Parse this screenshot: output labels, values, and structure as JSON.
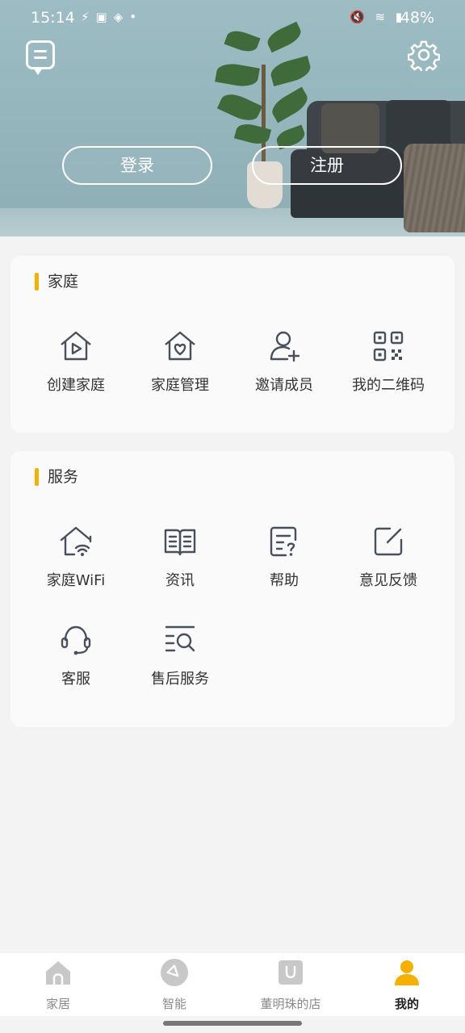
{
  "status_bar": {
    "time": "15:14",
    "battery": "48%"
  },
  "header": {
    "login_label": "登录",
    "register_label": "注册"
  },
  "home_section": {
    "title": "家庭",
    "items": [
      {
        "label": "创建家庭",
        "icon": "house-play-icon"
      },
      {
        "label": "家庭管理",
        "icon": "house-heart-icon"
      },
      {
        "label": "邀请成员",
        "icon": "user-add-icon"
      },
      {
        "label": "我的二维码",
        "icon": "qr-code-icon"
      }
    ]
  },
  "service_section": {
    "title": "服务",
    "items": [
      {
        "label": "家庭WiFi",
        "icon": "house-wifi-icon"
      },
      {
        "label": "资讯",
        "icon": "book-icon"
      },
      {
        "label": "帮助",
        "icon": "help-doc-icon"
      },
      {
        "label": "意见反馈",
        "icon": "edit-icon"
      },
      {
        "label": "客服",
        "icon": "headset-icon"
      },
      {
        "label": "售后服务",
        "icon": "search-list-icon"
      }
    ]
  },
  "bottom_nav": {
    "items": [
      {
        "label": "家居",
        "icon": "home-icon"
      },
      {
        "label": "智能",
        "icon": "smart-icon"
      },
      {
        "label": "董明珠的店",
        "icon": "store-icon"
      },
      {
        "label": "我的",
        "icon": "profile-icon",
        "active": true
      }
    ]
  },
  "colors": {
    "accent": "#f6b100",
    "icon_stroke": "#4a4f5c",
    "banner": "#9dbcc3",
    "nav_inactive": "#c8c8c8"
  }
}
